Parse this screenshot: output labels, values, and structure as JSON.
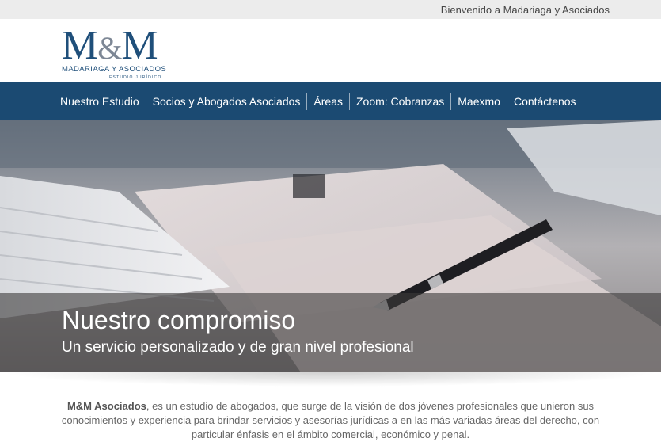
{
  "topbar": {
    "welcome": "Bienvenido a Madariaga y Asociados"
  },
  "logo": {
    "mark_left": "M",
    "mark_amp": "&",
    "mark_right": "M",
    "name": "MADARIAGA Y ASOCIADOS",
    "tagline": "ESTUDIO JURÍDICO"
  },
  "nav": {
    "items": [
      {
        "label": "Nuestro Estudio"
      },
      {
        "label": "Socios y Abogados Asociados"
      },
      {
        "label": "Áreas"
      },
      {
        "label": "Zoom: Cobranzas"
      },
      {
        "label": "Maexmo"
      },
      {
        "label": "Contáctenos"
      }
    ]
  },
  "hero": {
    "title": "Nuestro compromiso",
    "subtitle": "Un servicio personalizado y de gran nivel profesional"
  },
  "intro": {
    "company": "M&M Asociados",
    "text": ", es un estudio de abogados, que surge de la visión de dos jóvenes profesionales que unieron sus conocimientos y experiencia para brindar servicios y asesorías jurídicas a en las más variadas áreas del derecho, con particular énfasis en el ámbito comercial, económico y penal."
  },
  "colors": {
    "nav_background": "#1b4a72",
    "logo_blue": "#1f4f7a",
    "topbar_background": "#ececec"
  }
}
